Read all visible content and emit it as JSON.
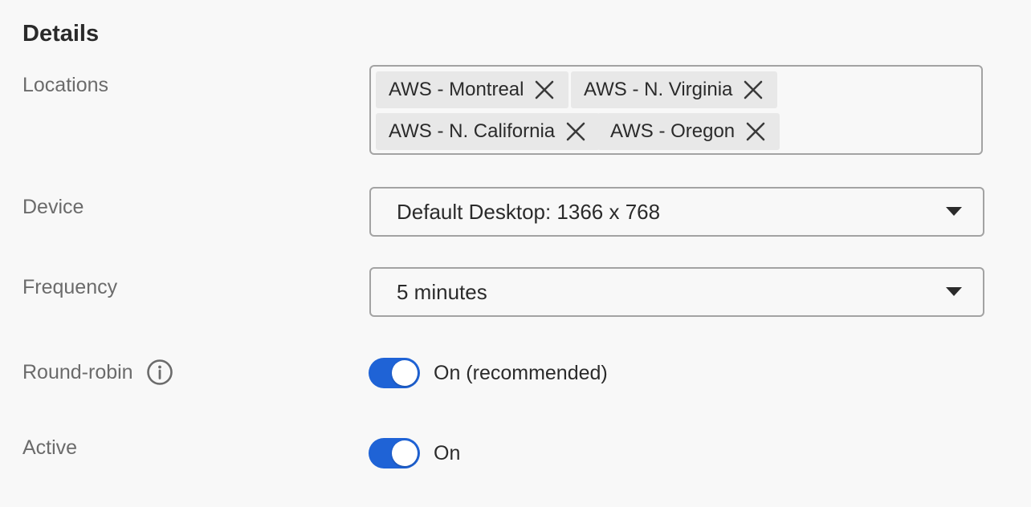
{
  "section": {
    "title": "Details"
  },
  "locations": {
    "label": "Locations",
    "chips": [
      {
        "label": "AWS - Montreal"
      },
      {
        "label": "AWS - N. Virginia"
      },
      {
        "label": "AWS - N. California"
      },
      {
        "label": "AWS - Oregon"
      }
    ],
    "remove_icon": "close-icon"
  },
  "device": {
    "label": "Device",
    "value": "Default Desktop: 1366 x 768",
    "icon": "caret-down-icon"
  },
  "frequency": {
    "label": "Frequency",
    "value": "5 minutes",
    "icon": "caret-down-icon"
  },
  "round_robin": {
    "label": "Round-robin",
    "icon": "info-icon",
    "enabled": true,
    "status": "On (recommended)"
  },
  "active": {
    "label": "Active",
    "enabled": true,
    "status": "On"
  },
  "colors": {
    "accent": "#1f63d6",
    "background": "#f8f8f8",
    "chip": "#e8e8e8",
    "border": "#a3a3a3",
    "label": "#6b6b6b"
  }
}
